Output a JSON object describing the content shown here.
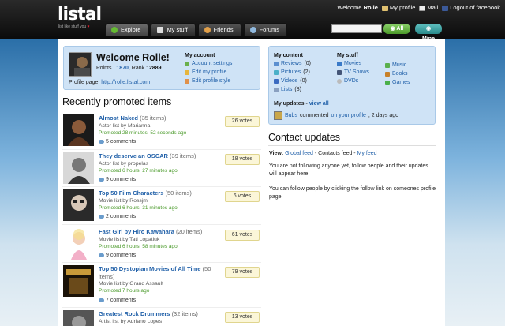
{
  "brand": {
    "logo": "listal",
    "tagline": "list like stuff you",
    "tagline_heart": "♥"
  },
  "toplinks": {
    "welcome": "Welcome",
    "username": "Rolle",
    "my_profile": "My profile",
    "mail": "Mail",
    "logout": "Logout of facebook"
  },
  "tabs": [
    {
      "label": "Explore",
      "icon": "globe-icon",
      "color": "#66bb33",
      "active": true
    },
    {
      "label": "My stuff",
      "icon": "folder-icon",
      "color": "#dddddd"
    },
    {
      "label": "Friends",
      "icon": "people-icon",
      "color": "#e2a04a"
    },
    {
      "label": "Forums",
      "icon": "chat-bubble-icon",
      "color": "#8fb8dd"
    }
  ],
  "search": {
    "value": "",
    "all_label": "All",
    "mine_label": "Mine"
  },
  "welcome": {
    "title": "Welcome Rolle!",
    "points_label": "Points :",
    "points": "1870",
    "rank_label": ", Rank :",
    "rank": "2889",
    "profile_label": "Profile page:",
    "profile_url": "http://rolle.listal.com"
  },
  "account": {
    "heading": "My account",
    "links": [
      {
        "label": "Account settings",
        "color": "#6ab04c"
      },
      {
        "label": "Edit my profile",
        "color": "#e6b53c"
      },
      {
        "label": "Edit profile style",
        "color": "#e0914a"
      }
    ]
  },
  "my_content": {
    "heading": "My content",
    "items": [
      {
        "label": "Reviews",
        "count": "(0)",
        "color": "#5b8fd0"
      },
      {
        "label": "Pictures",
        "count": "(2)",
        "color": "#4ab0c8"
      },
      {
        "label": "Videos",
        "count": "(0)",
        "color": "#3a6ac0"
      },
      {
        "label": "Lists",
        "count": "(8)",
        "color": "#8aa0c0"
      }
    ]
  },
  "my_stuff": {
    "heading": "My stuff",
    "items": [
      {
        "label": "Movies",
        "color": "#3a7ac8"
      },
      {
        "label": "TV Shows",
        "color": "#445577"
      },
      {
        "label": "DVDs",
        "color": "#bbbbbb"
      }
    ],
    "items2": [
      {
        "label": "Music",
        "color": "#5ab04c"
      },
      {
        "label": "Books",
        "color": "#c8812a"
      },
      {
        "label": "Games",
        "color": "#4ab04a"
      }
    ]
  },
  "my_updates": {
    "heading": "My updates",
    "view_all": "view all",
    "user": "Bubs",
    "action": "commented",
    "on": "on your profile",
    "time": ", 2 days ago"
  },
  "recently_promoted": {
    "title": "Recently promoted items",
    "items": [
      {
        "title": "Almost Naked",
        "count": "(35 items)",
        "by": "Actor list by Marianna",
        "promoted": "Promoted 28 minutes, 52 seconds ago",
        "comments": "5 comments",
        "votes": "26 votes",
        "thumb": "#5a3520"
      },
      {
        "title": "They deserve an OSCAR",
        "count": "(39 items)",
        "by": "Actor list by propelas",
        "promoted": "Promoted 6 hours, 27 minutes ago",
        "comments": "9 comments",
        "votes": "18 votes",
        "thumb": "#6a6a6a"
      },
      {
        "title": "Top 50 Film Characters",
        "count": "(50 items)",
        "by": "Movie list by Rossjm",
        "promoted": "Promoted 6 hours, 31 minutes ago",
        "comments": "2 comments",
        "votes": "6 votes",
        "thumb": "#3a3a3a"
      },
      {
        "title": "Fast Girl by Hiro Kawahara",
        "count": "(20 items)",
        "by": "Movie list by Tati Lopatiuk",
        "promoted": "Promoted 6 hours, 58 minutes ago",
        "comments": "9 comments",
        "votes": "61 votes",
        "thumb": "#f3d0d8"
      },
      {
        "title": "Top 50 Dystopian Movies of All Time",
        "count": "(50 items)",
        "by": "Movie list by Grand Assault",
        "promoted": "Promoted 7 hours ago",
        "comments": "7 comments",
        "votes": "79 votes",
        "thumb": "#3a2a10"
      },
      {
        "title": "Greatest Rock Drummers",
        "count": "(32 items)",
        "by": "Artist list by Adriano Lopes",
        "promoted": "",
        "comments": "",
        "votes": "13 votes",
        "thumb": "#555555"
      }
    ]
  },
  "contact_updates": {
    "title": "Contact updates",
    "view_label": "View:",
    "global": "Global feed",
    "contacts": "Contacts feed",
    "my_feed": "My feed",
    "p1": "You are not following anyone yet, follow people and their updates will appear here",
    "p2": "You can follow people by clicking the follow link on someones profile page."
  }
}
